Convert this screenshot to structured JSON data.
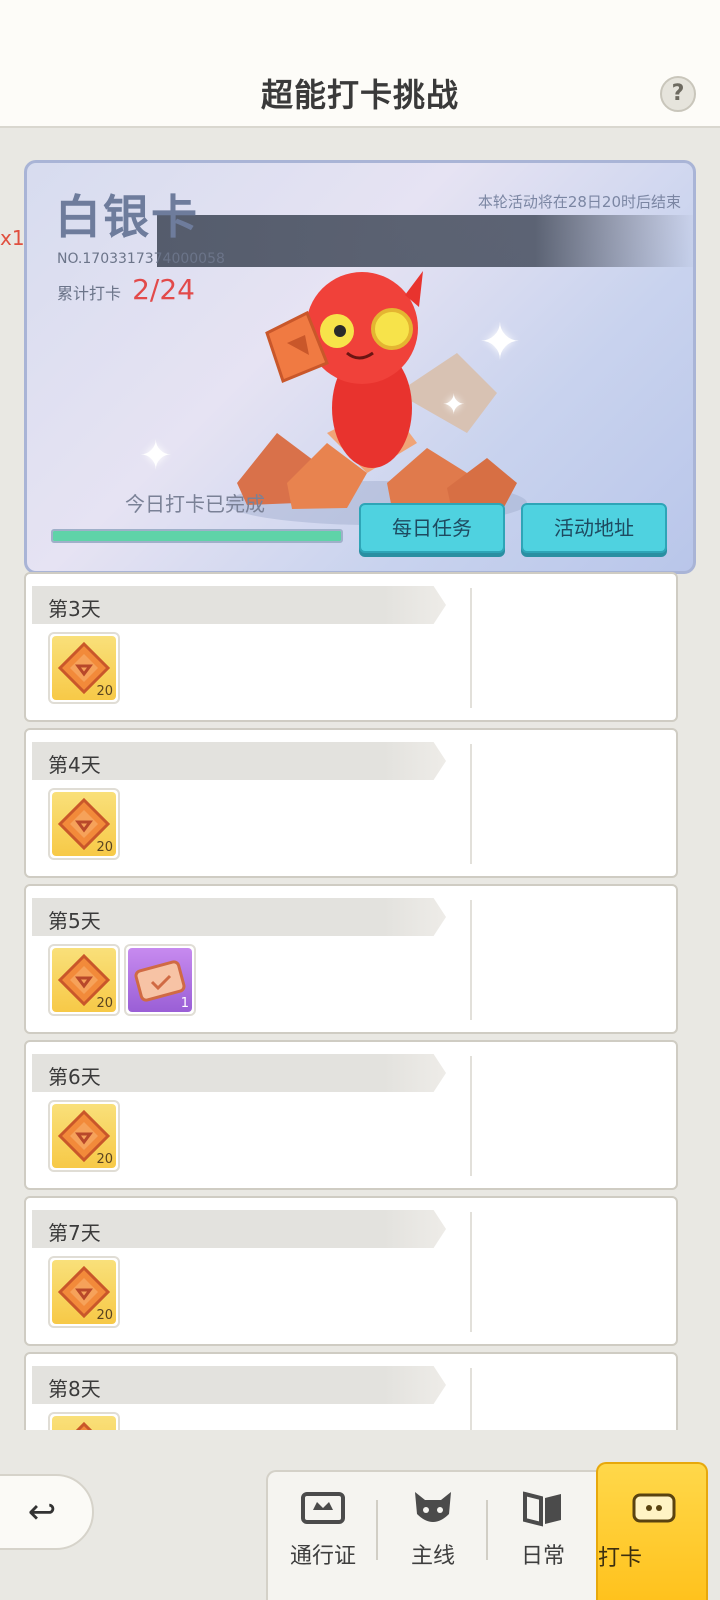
{
  "header": {
    "title": "超能打卡挑战",
    "help_label": "?"
  },
  "edge_label": "x1",
  "banner": {
    "card_tier": "白银卡",
    "end_notice": "本轮活动将在28日20时后结束",
    "serial_no": "NO.1703317374000058",
    "count_label": "累计打卡",
    "count_value": "2/24",
    "done_text": "今日打卡已完成",
    "progress": 1.0,
    "buttons": {
      "daily_tasks": "每日任务",
      "activity_address": "活动地址"
    }
  },
  "days": [
    {
      "label": "第3天",
      "rewards": [
        {
          "type": "gem",
          "count": "20"
        }
      ]
    },
    {
      "label": "第4天",
      "rewards": [
        {
          "type": "gem",
          "count": "20"
        }
      ]
    },
    {
      "label": "第5天",
      "rewards": [
        {
          "type": "gem",
          "count": "20"
        },
        {
          "type": "ticket",
          "count": "1"
        }
      ]
    },
    {
      "label": "第6天",
      "rewards": [
        {
          "type": "gem",
          "count": "20"
        }
      ]
    },
    {
      "label": "第7天",
      "rewards": [
        {
          "type": "gem",
          "count": "20"
        }
      ]
    },
    {
      "label": "第8天",
      "rewards": [
        {
          "type": "gem",
          "count": ""
        }
      ]
    }
  ],
  "back_icon": "back-arrow-icon",
  "nav": {
    "tabs": [
      {
        "label": "通行证",
        "icon": "pass-card-icon"
      },
      {
        "label": "主线",
        "icon": "demon-face-icon"
      },
      {
        "label": "日常",
        "icon": "book-icon"
      },
      {
        "label": "打卡",
        "icon": "check-in-ticket-icon",
        "active": true
      }
    ]
  },
  "colors": {
    "accent_cyan": "#4fd2e0",
    "count_red": "#e24a4a",
    "active_tab": "#ffc21d",
    "progress_green": "#5fd3a8"
  }
}
